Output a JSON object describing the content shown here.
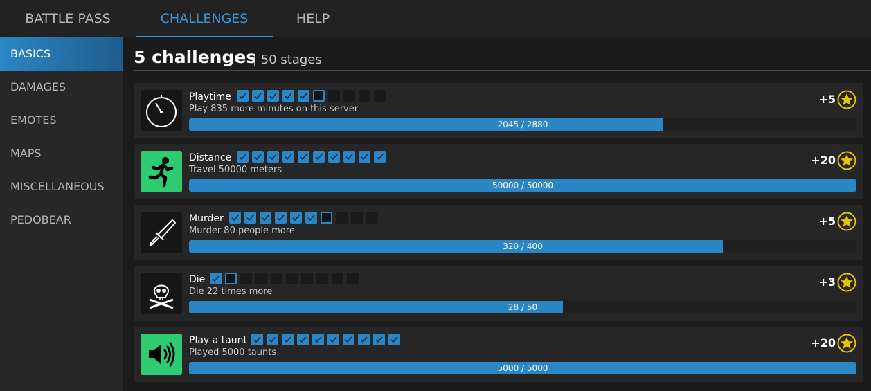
{
  "tabs": [
    {
      "label": "BATTLE PASS",
      "active": false
    },
    {
      "label": "CHALLENGES",
      "active": true
    },
    {
      "label": "HELP",
      "active": false
    }
  ],
  "sidebar": {
    "items": [
      {
        "label": "BASICS",
        "active": true
      },
      {
        "label": "DAMAGES",
        "active": false
      },
      {
        "label": "EMOTES",
        "active": false
      },
      {
        "label": "MAPS",
        "active": false
      },
      {
        "label": "MISCELLANEOUS",
        "active": false
      },
      {
        "label": "PEDOBEAR",
        "active": false
      }
    ]
  },
  "main": {
    "title": "5 challenges",
    "subtitle": "| 50 stages"
  },
  "colors": {
    "accent": "#2a86c5",
    "icon_green": "#2ecc71",
    "star": "#e6c200"
  },
  "challenges": [
    {
      "title": "Playtime",
      "description": "Play 835 more minutes on this server",
      "icon": "stopwatch-icon",
      "icon_bg": "dark",
      "stages_done": 5,
      "stages_total": 10,
      "progress_text": "2045 / 2880",
      "progress_fraction": 0.71,
      "reward": "+5"
    },
    {
      "title": "Distance",
      "description": "Travel 50000 meters",
      "icon": "running-man-icon",
      "icon_bg": "green",
      "stages_done": 10,
      "stages_total": 10,
      "progress_text": "50000 / 50000",
      "progress_fraction": 1.0,
      "reward": "+20"
    },
    {
      "title": "Murder",
      "description": "Murder 80 people more",
      "icon": "knife-icon",
      "icon_bg": "dark",
      "stages_done": 6,
      "stages_total": 10,
      "progress_text": "320 / 400",
      "progress_fraction": 0.8,
      "reward": "+5"
    },
    {
      "title": "Die",
      "description": "Die 22 times more",
      "icon": "skull-crossbones-icon",
      "icon_bg": "dark",
      "stages_done": 1,
      "stages_total": 10,
      "progress_text": "28 / 50",
      "progress_fraction": 0.56,
      "reward": "+3"
    },
    {
      "title": "Play a taunt",
      "description": "Played 5000 taunts",
      "icon": "speaker-icon",
      "icon_bg": "green",
      "stages_done": 10,
      "stages_total": 10,
      "progress_text": "5000 / 5000",
      "progress_fraction": 1.0,
      "reward": "+20"
    }
  ]
}
